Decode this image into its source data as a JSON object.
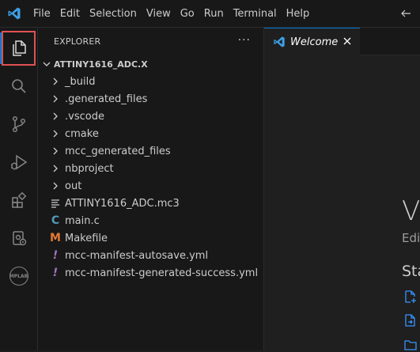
{
  "menu": [
    "File",
    "Edit",
    "Selection",
    "View",
    "Go",
    "Run",
    "Terminal",
    "Help"
  ],
  "sidebar": {
    "title": "EXPLORER",
    "more": "···",
    "folder": "ATTINY1616_ADC.X",
    "items": [
      {
        "label": "_build",
        "kind": "folder"
      },
      {
        "label": ".generated_files",
        "kind": "folder"
      },
      {
        "label": ".vscode",
        "kind": "folder"
      },
      {
        "label": "cmake",
        "kind": "folder"
      },
      {
        "label": "mcc_generated_files",
        "kind": "folder"
      },
      {
        "label": "nbproject",
        "kind": "folder"
      },
      {
        "label": "out",
        "kind": "folder"
      },
      {
        "label": "ATTINY1616_ADC.mc3",
        "kind": "file-text"
      },
      {
        "label": "main.c",
        "kind": "file-c"
      },
      {
        "label": "Makefile",
        "kind": "file-makefile"
      },
      {
        "label": "mcc-manifest-autosave.yml",
        "kind": "file-yaml"
      },
      {
        "label": "mcc-manifest-generated-success.yml",
        "kind": "file-yaml"
      }
    ]
  },
  "activity": {
    "mplab_label": "MPLAB"
  },
  "editor": {
    "tab_label": "Welcome",
    "welcome_big": "V",
    "welcome_sub": "Edi",
    "welcome_start": "Sta"
  },
  "icons": {
    "file_c": "C",
    "file_makefile": "M",
    "file_yaml": "!"
  },
  "colors": {
    "accent": "#0078d4",
    "highlight_outline": "#e05252",
    "c_icon": "#519aba",
    "makefile_icon": "#e37933",
    "yaml_icon": "#a074c4"
  }
}
